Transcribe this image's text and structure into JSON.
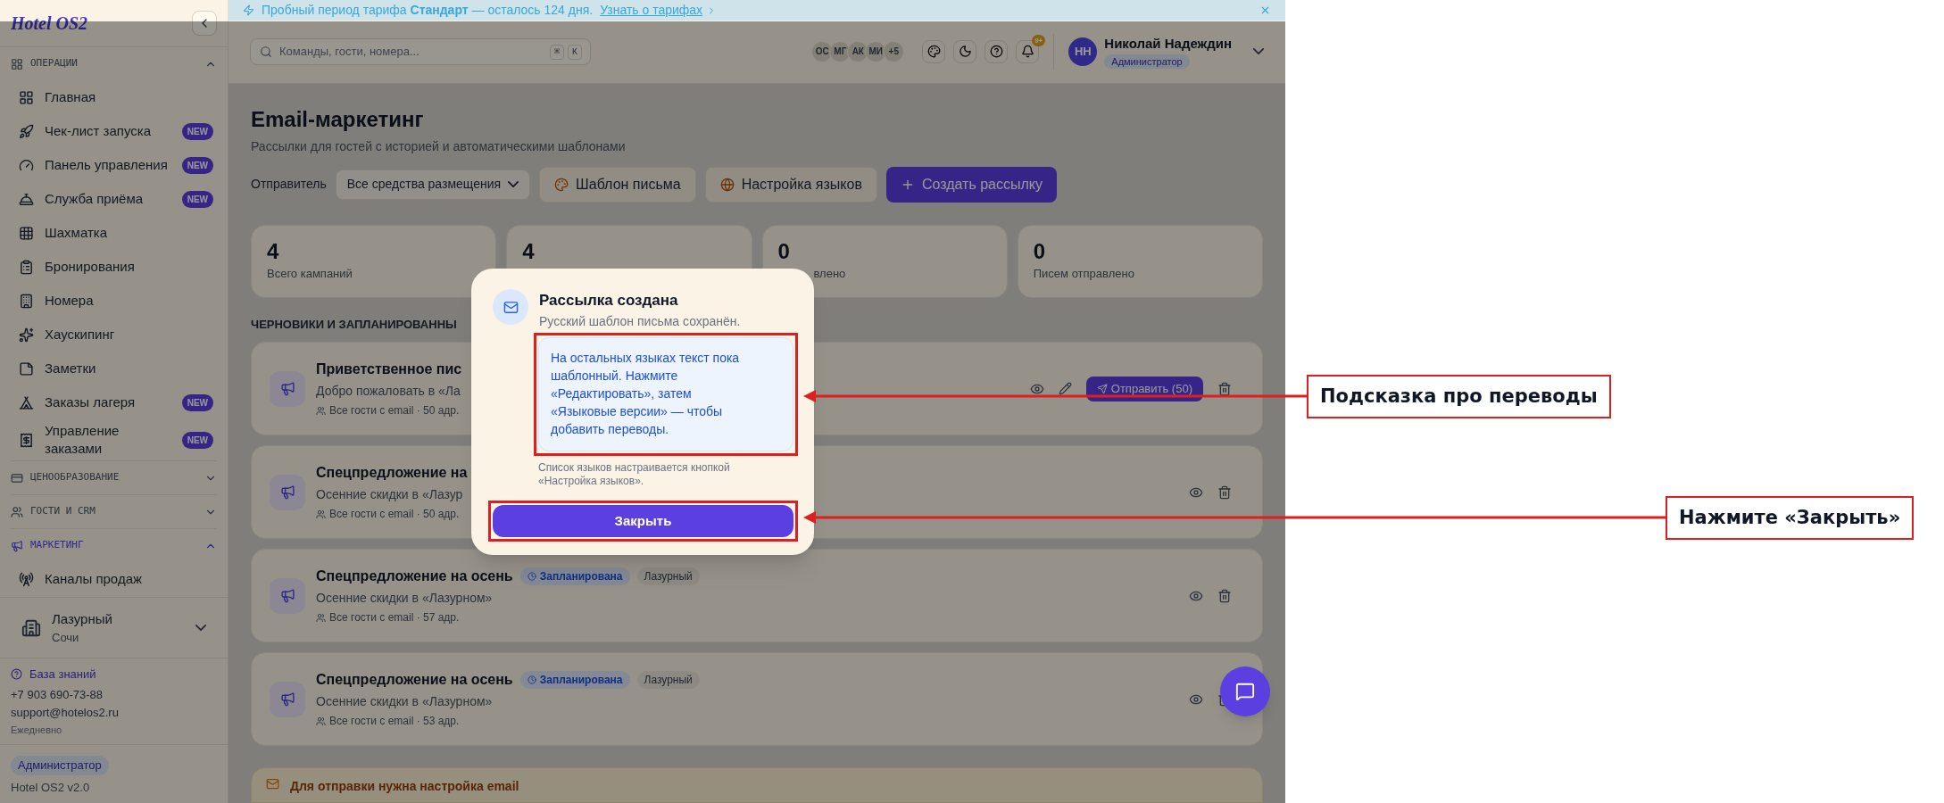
{
  "banner": {
    "text": "Пробный период тарифа **Стандарт** — осталось 124 дня.",
    "link": "Узнать о тарифах"
  },
  "sidebar": {
    "logo": "Hotel OS2",
    "sections": [
      {
        "title": "ОПЕРАЦИИ",
        "expanded": true,
        "selected": false,
        "items": [
          {
            "label": "Главная"
          },
          {
            "label": "Чек-лист запуска",
            "badge": "NEW"
          },
          {
            "label": "Панель управления",
            "badge": "NEW"
          },
          {
            "label": "Служба приёма",
            "badge": "NEW"
          },
          {
            "label": "Шахматка"
          },
          {
            "label": "Бронирования"
          },
          {
            "label": "Номера"
          },
          {
            "label": "Хаускипинг"
          },
          {
            "label": "Заметки"
          },
          {
            "label": "Заказы лагеря",
            "badge": "NEW"
          },
          {
            "label": "Управление заказами",
            "badge": "NEW"
          }
        ]
      },
      {
        "title": "ЦЕНООБРАЗОВАНИЕ",
        "expanded": false,
        "selected": false
      },
      {
        "title": "ГОСТИ И CRM",
        "expanded": false,
        "selected": false
      },
      {
        "title": "МАРКЕТИНГ",
        "expanded": true,
        "selected": true,
        "items": [
          {
            "label": "Каналы продаж"
          }
        ]
      }
    ],
    "property": {
      "name": "Лазурный",
      "city": "Сочи"
    },
    "help": {
      "link": "База знаний",
      "phone": "+7 903 690-73-88",
      "email": "support@hotelos2.ru",
      "hours": "Ежедневно"
    },
    "role": "Администратор",
    "version": "Hotel OS2 v2.0"
  },
  "header": {
    "search": {
      "placeholder": "Команды, гости, номера...",
      "keys": [
        "⌘",
        "K"
      ]
    },
    "avatars": [
      "ОС",
      "МГ",
      "АК",
      "МИ",
      "+5"
    ],
    "notifications": "9+",
    "user": {
      "initials": "НН",
      "name": "Николай Надеждин",
      "role": "Администратор"
    }
  },
  "page": {
    "title": "Email-маркетинг",
    "subtitle": "Рассылки для гостей с историей и автоматическими шаблонами",
    "sender_label": "Отправитель",
    "sender_value": "Все средства размещения",
    "buttons": [
      {
        "label": "Шаблон письма",
        "kind": "template"
      },
      {
        "label": "Настройка языков",
        "kind": "languages"
      },
      {
        "label": "Создать рассылку",
        "kind": "primary"
      }
    ],
    "stats": [
      {
        "value": "4",
        "label": "Всего кампаний",
        "covered": false
      },
      {
        "value": "4"
      },
      {
        "value": "0",
        "label": "влено",
        "covered": true
      },
      {
        "value": "0",
        "label": "Писем отправлено",
        "covered": false
      }
    ],
    "section_title": "ЧЕРНОВИКИ И ЗАПЛАНИРОВАННЫ",
    "campaigns": [
      {
        "title": "Приветственное пис",
        "subtitle": "Добро пожаловать в «Ла",
        "meta": "Все гости с email · 50 адр.",
        "editable": true,
        "send_button": "Отправить (50)"
      },
      {
        "title": "Спецпредложение на",
        "subtitle": "Осенние скидки в «Лазур",
        "meta": "Все гости с email · 50 адр.",
        "editable": false
      },
      {
        "title": "Спецпредложение на осень",
        "status": "Запланирована",
        "property": "Лазурный",
        "subtitle": "Осенние скидки в «Лазурном»",
        "meta": "Все гости с email · 57 адр.",
        "editable": false
      },
      {
        "title": "Спецпредложение на осень",
        "status": "Запланирована",
        "property": "Лазурный",
        "subtitle": "Осенние скидки в «Лазурном»",
        "meta": "Все гости с email · 53 адр.",
        "editable": false
      }
    ],
    "notice": "Для отправки нужна настройка email"
  },
  "modal": {
    "title": "Рассылка создана",
    "text": "Русский шаблон письма сохранён.",
    "hint": "На остальных языках текст пока шаблонный. Нажмите «Редактировать», затем «Языковые версии» — чтобы добавить переводы.",
    "note": "Список языков настраивается кнопкой «Настройка языков».",
    "button": "Закрыть"
  },
  "annotations": [
    {
      "label": "Подсказка про переводы"
    },
    {
      "label": "Нажмите «Закрыть»"
    }
  ]
}
